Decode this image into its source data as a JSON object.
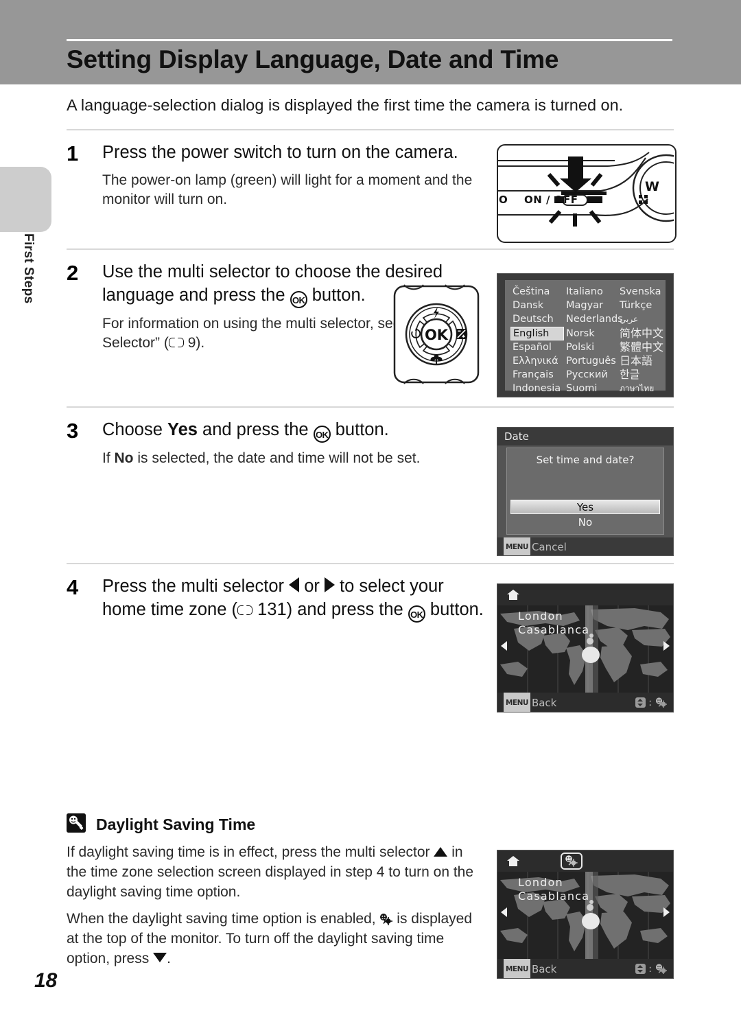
{
  "header": {
    "title": "Setting Display Language, Date and Time"
  },
  "sidebar": {
    "chapter_label": "First Steps"
  },
  "intro": "A language-selection dialog is displayed the first time the camera is turned on.",
  "steps": [
    {
      "number": "1",
      "heading": "Press the power switch to turn on the camera.",
      "body": "The power-on lamp (green) will light for a moment and the monitor will turn on."
    },
    {
      "number": "2",
      "heading_part1": "Use the multi selector to choose the desired language and press the ",
      "heading_part2": " button.",
      "body_part1": "For information on using the multi selector, see “The Multi Selector” (",
      "body_page": " 9)."
    },
    {
      "number": "3",
      "heading_part1": "Choose ",
      "heading_yes": "Yes",
      "heading_part2": " and press the ",
      "heading_part3": " button.",
      "body_part1": "If ",
      "body_no": "No",
      "body_part2": " is selected, the date and time will not be set."
    },
    {
      "number": "4",
      "heading_part1": "Press the multi selector ",
      "heading_or": " or ",
      "heading_part2": " to select your home time zone (",
      "heading_page": " 131) and press the ",
      "heading_part3": " button."
    }
  ],
  "camera_figure": {
    "switch_label": "ON / OFF",
    "mode_label": "O",
    "zoom_wide_label": "W"
  },
  "multi_selector": {
    "center_label": "OK",
    "flash_icon": "flash-icon",
    "timer_icon": "self-timer-icon",
    "exposure_icon": "exposure-compensation-icon",
    "macro_icon": "macro-flower-icon"
  },
  "language_screen": {
    "languages": [
      {
        "label": "Čeština",
        "selected": false,
        "style": ""
      },
      {
        "label": "Italiano",
        "selected": false,
        "style": ""
      },
      {
        "label": "Svenska",
        "selected": false,
        "style": ""
      },
      {
        "label": "Dansk",
        "selected": false,
        "style": ""
      },
      {
        "label": "Magyar",
        "selected": false,
        "style": ""
      },
      {
        "label": "Türkçe",
        "selected": false,
        "style": ""
      },
      {
        "label": "Deutsch",
        "selected": false,
        "style": ""
      },
      {
        "label": "Nederlands",
        "selected": false,
        "style": ""
      },
      {
        "label": "عربي",
        "selected": false,
        "style": "small"
      },
      {
        "label": "English",
        "selected": true,
        "style": ""
      },
      {
        "label": "Norsk",
        "selected": false,
        "style": ""
      },
      {
        "label": "简体中文",
        "selected": false,
        "style": "cjk"
      },
      {
        "label": "Español",
        "selected": false,
        "style": ""
      },
      {
        "label": "Polski",
        "selected": false,
        "style": ""
      },
      {
        "label": "繁體中文",
        "selected": false,
        "style": "cjk"
      },
      {
        "label": "Ελληνικά",
        "selected": false,
        "style": ""
      },
      {
        "label": "Português",
        "selected": false,
        "style": ""
      },
      {
        "label": "日本語",
        "selected": false,
        "style": "cjk"
      },
      {
        "label": "Français",
        "selected": false,
        "style": ""
      },
      {
        "label": "Русский",
        "selected": false,
        "style": ""
      },
      {
        "label": "한글",
        "selected": false,
        "style": "cjk"
      },
      {
        "label": "Indonesia",
        "selected": false,
        "style": ""
      },
      {
        "label": "Suomi",
        "selected": false,
        "style": ""
      },
      {
        "label": "ภาษาไทย",
        "selected": false,
        "style": "small"
      }
    ]
  },
  "date_screen": {
    "title": "Date",
    "question": "Set time and date?",
    "yes_label": "Yes",
    "no_label": "No",
    "footer_chip": "MENU",
    "footer_label": "Cancel"
  },
  "map_screen_1": {
    "city_primary": "London",
    "city_secondary": "Casablanca",
    "footer_chip": "MENU",
    "footer_label": "Back",
    "footer_separator": ":",
    "home_icon": "home-icon",
    "dst_enabled": false
  },
  "map_screen_2": {
    "city_primary": "London",
    "city_secondary": "Casablanca",
    "footer_chip": "MENU",
    "footer_label": "Back",
    "footer_separator": ":",
    "home_icon": "home-icon",
    "dst_enabled": true
  },
  "tip": {
    "heading": "Daylight Saving Time",
    "paragraph1_part1": "If daylight saving time is in effect, press the multi selector ",
    "paragraph1_part2": " in the time zone selection screen displayed in step 4 to turn on the daylight saving time option.",
    "paragraph2_part1": "When the daylight saving time option is enabled, ",
    "paragraph2_part2": " is displayed at the top of the monitor. To turn off the daylight saving time option, press ",
    "paragraph2_part3": "."
  },
  "page_number": "18",
  "colors": {
    "header_band": "#979797",
    "side_tab": "#cdcdcd",
    "rule": "#d8d8d8",
    "screen_dark": "#3b3b3b",
    "screen_mid": "#6d6d6d"
  }
}
